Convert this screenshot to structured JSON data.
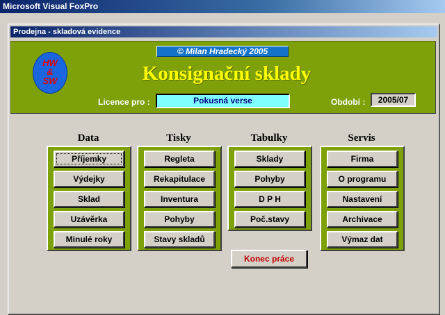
{
  "app": {
    "title": "Microsoft Visual FoxPro"
  },
  "form": {
    "title": "Prodejna - skladová evidence"
  },
  "header": {
    "copyright": "©  Milan Hradecký  2005",
    "logo_lines": [
      "HW",
      "&",
      "SW"
    ],
    "title": "Konsignační sklady",
    "licence_label": "Licence pro :",
    "licence_value": "Pokusná verse",
    "period_label": "Období :",
    "period_value": "2005/07"
  },
  "sections": [
    {
      "title": "Data",
      "buttons": [
        "Příjemky",
        "Výdejky",
        "Sklad",
        "Uzávěrka",
        "Minulé roky"
      ]
    },
    {
      "title": "Tisky",
      "buttons": [
        "Regleta",
        "Rekapitulace",
        "Inventura",
        "Pohyby",
        "Stavy skladů"
      ]
    },
    {
      "title": "Tabulky",
      "buttons": [
        "Sklady",
        "Pohyby",
        "D P H",
        "Poč.stavy"
      ]
    },
    {
      "title": "Servis",
      "buttons": [
        "Firma",
        "O programu",
        "Nastavení",
        "Archivace",
        "Výmaz dat"
      ]
    }
  ],
  "quit_label": "Konec práce"
}
